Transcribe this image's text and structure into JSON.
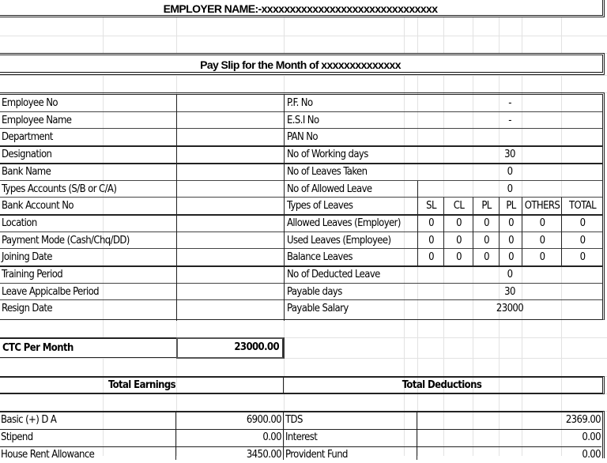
{
  "header": {
    "employer_name": "EMPLOYER NAME:-xxxxxxxxxxxxxxxxxxxxxxxxxxxxxxx",
    "payslip_title": "Pay Slip for the Month of xxxxxxxxxxxxxx"
  },
  "employee_details": [
    {
      "label": "Employee No",
      "value": ""
    },
    {
      "label": "Employee Name",
      "value": ""
    },
    {
      "label": "Department",
      "value": ""
    },
    {
      "label": "Designation",
      "value": ""
    },
    {
      "label": "Bank Name",
      "value": ""
    },
    {
      "label": "Types Accounts (S/B or C/A)",
      "value": ""
    },
    {
      "label": "Bank Account No",
      "value": ""
    },
    {
      "label": "Location",
      "value": ""
    },
    {
      "label": "Payment Mode (Cash/Chq/DD)",
      "value": ""
    },
    {
      "label": "Joining Date",
      "value": ""
    },
    {
      "label": "Training Period",
      "value": ""
    },
    {
      "label": "Leave Appicalbe Period",
      "value": ""
    },
    {
      "label": "Resign Date",
      "value": ""
    }
  ],
  "attendance": {
    "pf_no": {
      "label": "P.F. No",
      "value": "-"
    },
    "esi_no": {
      "label": "E.S.I No",
      "value": "-"
    },
    "pan_no": {
      "label": "PAN No",
      "value": ""
    },
    "working_days": {
      "label": "No of Working days",
      "value": "30"
    },
    "leaves_taken": {
      "label": "No of Leaves Taken",
      "value": "0"
    },
    "allowed_leave": {
      "label": "No of Allowed Leave",
      "value": "0"
    },
    "leave_types": {
      "label": "Types of Leaves",
      "columns": [
        "SL",
        "CL",
        "PL",
        "PL",
        "OTHERS",
        "TOTAL"
      ]
    },
    "leave_rows": [
      {
        "label": "Allowed Leaves (Employer)",
        "values": [
          "0",
          "0",
          "0",
          "0",
          "0",
          "0"
        ]
      },
      {
        "label": "Used Leaves (Employee)",
        "values": [
          "0",
          "0",
          "0",
          "0",
          "0",
          "0"
        ]
      },
      {
        "label": "Balance Leaves",
        "values": [
          "0",
          "0",
          "0",
          "0",
          "0",
          "0"
        ]
      }
    ],
    "deducted_leave": {
      "label": "No of Deducted Leave",
      "value": "0"
    },
    "payable_days": {
      "label": "Payable days",
      "value": "30"
    },
    "payable_salary": {
      "label": "Payable Salary",
      "value": "23000"
    }
  },
  "ctc": {
    "label": "CTC Per Month",
    "value": "23000.00"
  },
  "earnings": {
    "title": "Total Earnings",
    "items": [
      {
        "label": "Basic (+) D A",
        "value": "6900.00"
      },
      {
        "label": "Stipend",
        "value": "0.00"
      },
      {
        "label": "House Rent Allowance",
        "value": "3450.00"
      }
    ]
  },
  "deductions": {
    "title": "Total Deductions",
    "items": [
      {
        "label": "TDS",
        "value": "2369.00"
      },
      {
        "label": "Interest",
        "value": "0.00"
      },
      {
        "label": "Provident Fund",
        "value": "0.00"
      }
    ]
  }
}
